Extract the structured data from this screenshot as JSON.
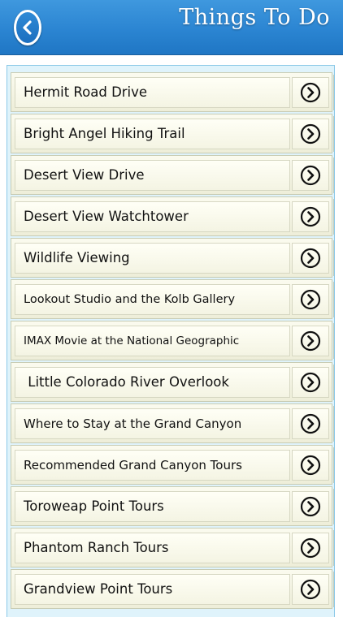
{
  "header": {
    "title": "Things To Do",
    "back_icon": "chevron-left-icon",
    "bar_color": "#2b85d2"
  },
  "list": {
    "arrow_icon": "chevron-right-circle-icon",
    "items": [
      {
        "label": "Hermit Road Drive"
      },
      {
        "label": "Bright Angel Hiking Trail"
      },
      {
        "label": "Desert View Drive"
      },
      {
        "label": "Desert View Watchtower"
      },
      {
        "label": "Wildlife Viewing"
      },
      {
        "label": "Lookout Studio and the Kolb Gallery"
      },
      {
        "label": "IMAX Movie at the National Geographic"
      },
      {
        "label": " Little Colorado River Overlook"
      },
      {
        "label": "Where to Stay at the Grand Canyon"
      },
      {
        "label": "Recommended Grand Canyon Tours"
      },
      {
        "label": "Toroweap Point Tours"
      },
      {
        "label": "Phantom Ranch Tours"
      },
      {
        "label": "Grandview Point Tours"
      }
    ]
  }
}
